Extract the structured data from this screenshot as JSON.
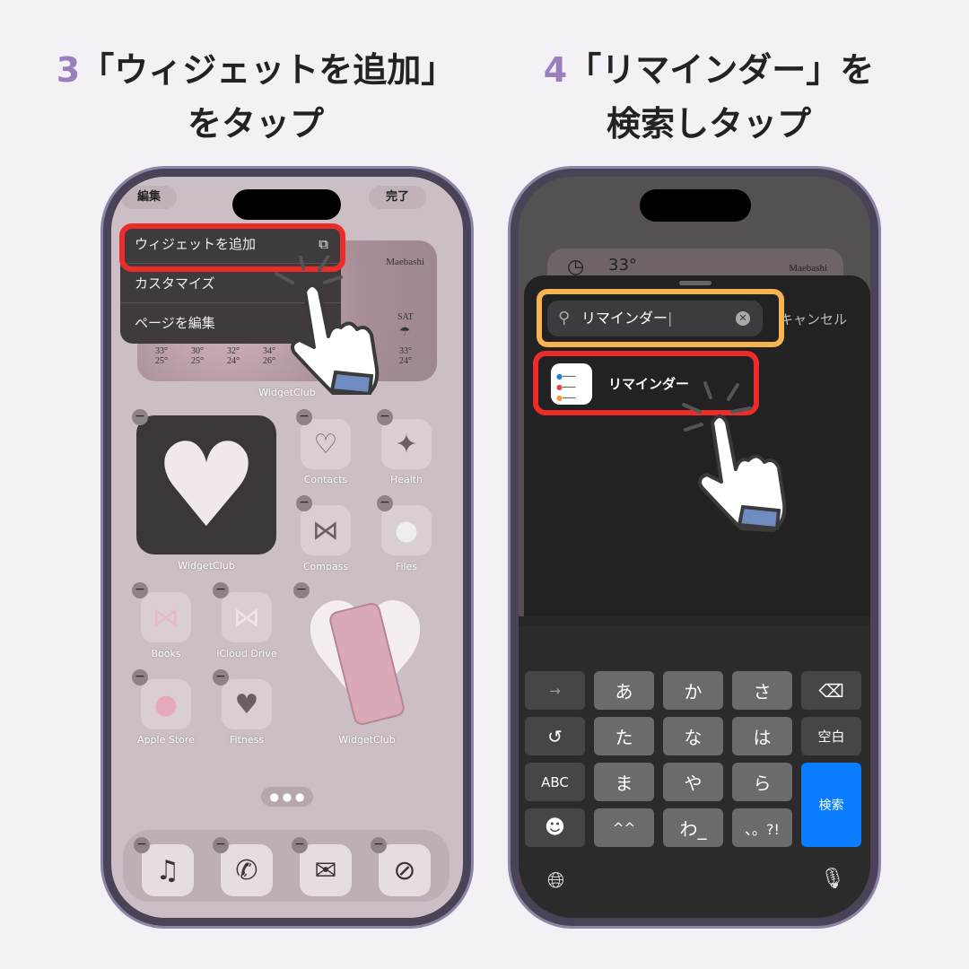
{
  "left": {
    "step": "3",
    "title_line1": "「ウィジェットを追加」",
    "title_line2": "をタップ",
    "edit_button": "編集",
    "done_button": "完了",
    "menu": [
      "ウィジェットを追加",
      "カスタマイズ",
      "ページを編集"
    ],
    "weather": {
      "city": "Maebashi",
      "day": "SAT",
      "highs": [
        "33°",
        "30°",
        "32°",
        "34°",
        "33°"
      ],
      "lows": [
        "25°",
        "25°",
        "24°",
        "26°",
        "24°"
      ]
    },
    "apps": {
      "widget1": "WidgetClub",
      "widget_large1": "WidgetClub",
      "contacts": "Contacts",
      "health": "Health",
      "compass": "Compass",
      "files": "Files",
      "books": "Books",
      "icloud": "iCloud Drive",
      "apple_store": "Apple Store",
      "fitness": "Fitness",
      "widget_large2": "WidgetClub"
    },
    "dock_icons": [
      "music-icon",
      "phone-icon",
      "mail-icon",
      "safari-icon"
    ]
  },
  "right": {
    "step": "4",
    "title_line1": "「リマインダー」を",
    "title_line2": "検索しタップ",
    "weather_city": "Maebashi",
    "weather_temp": "33°",
    "search_value": "リマインダー",
    "cancel": "キャンセル",
    "result": "リマインダー",
    "keys": {
      "r1": [
        "→",
        "あ",
        "か",
        "さ"
      ],
      "r2": [
        "た",
        "な",
        "は",
        "空白"
      ],
      "r3": [
        "ABC",
        "ま",
        "や",
        "ら"
      ],
      "r4": [
        "^^",
        "わ_",
        "、。?!"
      ],
      "search": "検索"
    }
  },
  "colors": {
    "accent_number": "#9b7ebd",
    "highlight_red": "#ee2b2b",
    "highlight_orange": "#f6b352",
    "search_key": "#0a7cff"
  }
}
